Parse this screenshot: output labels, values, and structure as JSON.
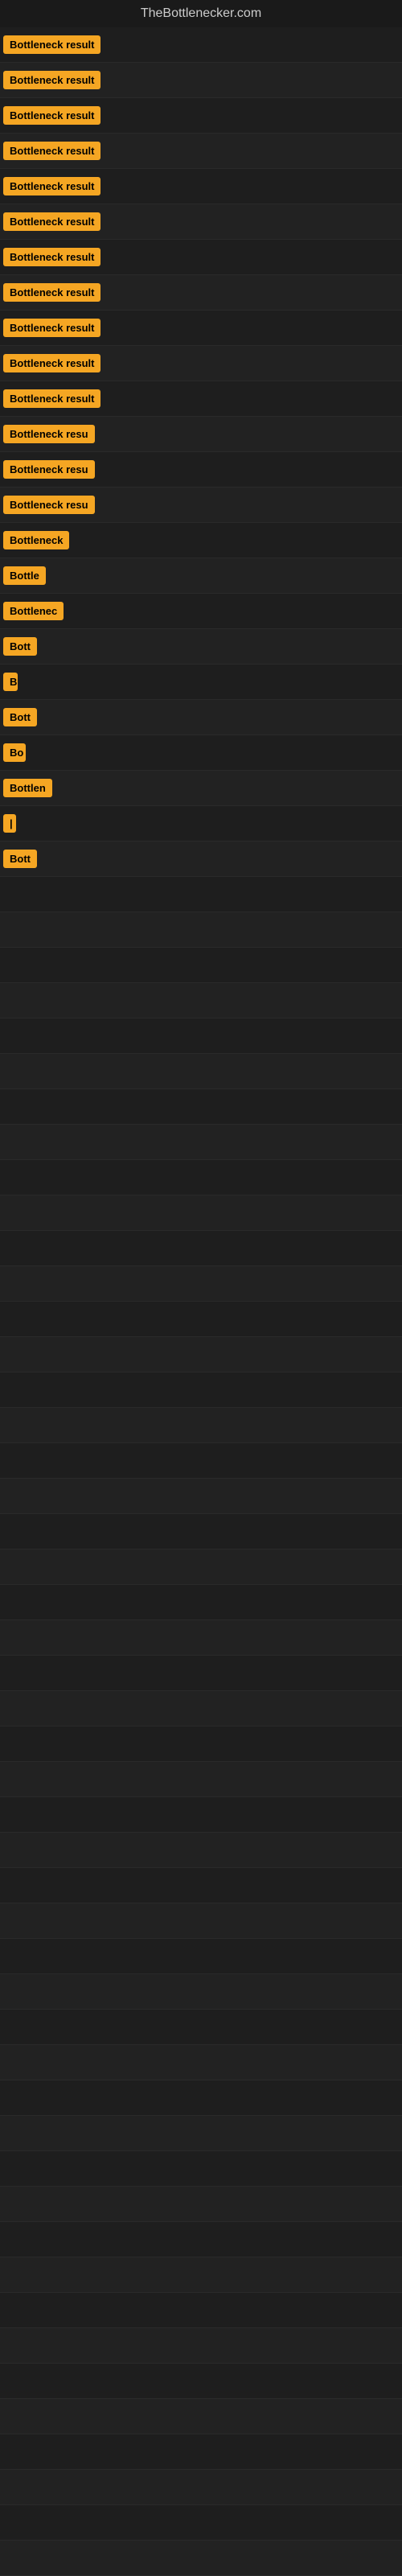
{
  "site": {
    "title": "TheBottlenecker.com"
  },
  "badges": [
    {
      "label": "Bottleneck result",
      "width": 155
    },
    {
      "label": "Bottleneck result",
      "width": 155
    },
    {
      "label": "Bottleneck result",
      "width": 155
    },
    {
      "label": "Bottleneck result",
      "width": 155
    },
    {
      "label": "Bottleneck result",
      "width": 155
    },
    {
      "label": "Bottleneck result",
      "width": 155
    },
    {
      "label": "Bottleneck result",
      "width": 155
    },
    {
      "label": "Bottleneck result",
      "width": 155
    },
    {
      "label": "Bottleneck result",
      "width": 155
    },
    {
      "label": "Bottleneck result",
      "width": 155
    },
    {
      "label": "Bottleneck result",
      "width": 155
    },
    {
      "label": "Bottleneck resu",
      "width": 130
    },
    {
      "label": "Bottleneck resu",
      "width": 130
    },
    {
      "label": "Bottleneck resu",
      "width": 130
    },
    {
      "label": "Bottleneck",
      "width": 90
    },
    {
      "label": "Bottle",
      "width": 55
    },
    {
      "label": "Bottlenec",
      "width": 78
    },
    {
      "label": "Bott",
      "width": 42
    },
    {
      "label": "B",
      "width": 18
    },
    {
      "label": "Bott",
      "width": 42
    },
    {
      "label": "Bo",
      "width": 28
    },
    {
      "label": "Bottlen",
      "width": 62
    },
    {
      "label": "|",
      "width": 10
    },
    {
      "label": "Bott",
      "width": 42
    }
  ]
}
